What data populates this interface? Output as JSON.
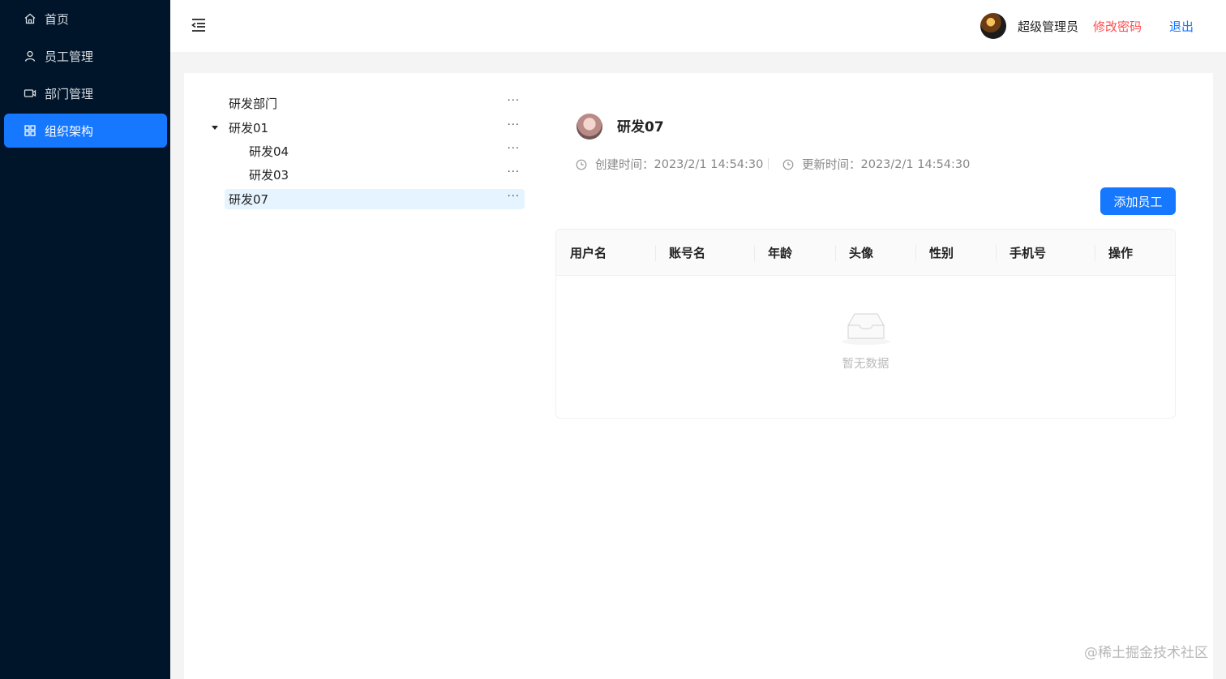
{
  "sidebar": {
    "items": [
      {
        "label": "首页",
        "icon": "home-icon"
      },
      {
        "label": "员工管理",
        "icon": "user-icon"
      },
      {
        "label": "部门管理",
        "icon": "video-icon"
      },
      {
        "label": "组织架构",
        "icon": "apps-icon",
        "active": true
      }
    ]
  },
  "header": {
    "user_name": "超级管理员",
    "change_password": "修改密码",
    "logout": "退出"
  },
  "tree": {
    "nodes": [
      {
        "label": "研发部门",
        "more": "···"
      },
      {
        "label": "研发01",
        "more": "···",
        "expanded": true
      },
      {
        "label": "研发04",
        "more": "···"
      },
      {
        "label": "研发03",
        "more": "···"
      },
      {
        "label": "研发07",
        "more": "···",
        "selected": true
      }
    ]
  },
  "detail": {
    "title": "研发07",
    "created_label": "创建时间：",
    "created_value": "2023/2/1 14:54:30",
    "updated_label": "更新时间：",
    "updated_value": "2023/2/1 14:54:30",
    "add_button": "添加员工"
  },
  "table": {
    "columns": [
      "用户名",
      "账号名",
      "年龄",
      "头像",
      "性别",
      "手机号",
      "操作"
    ],
    "rows": [],
    "empty_text": "暂无数据"
  },
  "colors": {
    "sidebar_bg": "#001529",
    "primary": "#1677ff",
    "danger": "#ff4d4f"
  },
  "watermark": "@稀土掘金技术社区"
}
